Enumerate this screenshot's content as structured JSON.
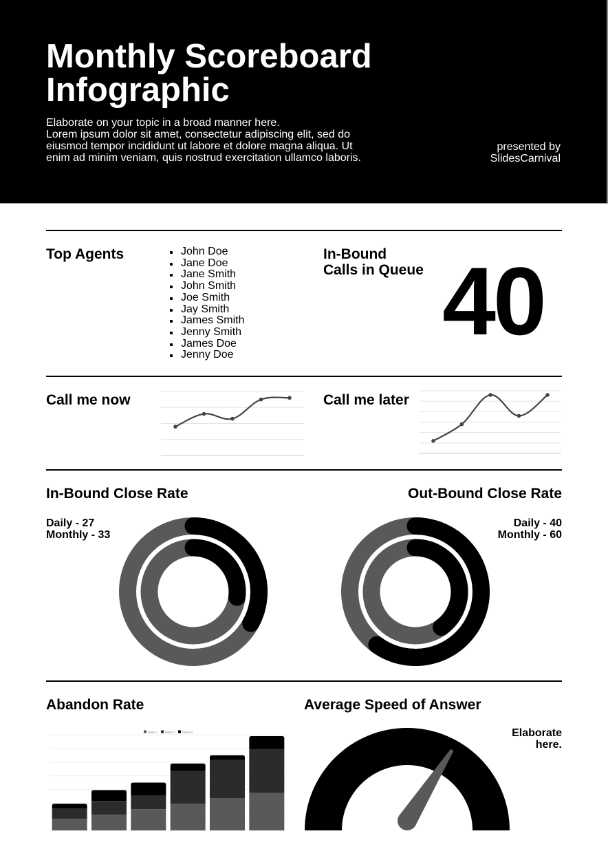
{
  "header": {
    "title_line1": "Monthly Scoreboard",
    "title_line2": "Infographic",
    "subtitle_lines": [
      "Elaborate on your topic in a broad manner here.",
      "Lorem ipsum dolor sit amet, consectetur adipiscing elit, sed do",
      "eiusmod tempor incididunt ut labore et dolore magna aliqua. Ut",
      "enim ad minim veniam, quis nostrud exercitation ullamco laboris."
    ],
    "presenter_line1": "presented by",
    "presenter_line2": "SlidesCarnival"
  },
  "top_agents": {
    "heading": "Top Agents",
    "agents": [
      "John Doe",
      "Jane Doe",
      "Jane Smith",
      "John Smith",
      "Joe Smith",
      "Jay Smith",
      "James Smith",
      "Jenny Smith",
      "James Doe",
      "Jenny Doe"
    ]
  },
  "calls_in_queue": {
    "heading_line1": "In-Bound",
    "heading_line2": "Calls in Queue",
    "value": "40"
  },
  "call_me_now": {
    "heading": "Call me now"
  },
  "call_me_later": {
    "heading": "Call me later"
  },
  "inbound_close_rate": {
    "heading": "In-Bound Close Rate",
    "daily_label": "Daily - 27",
    "monthly_label": "Monthly - 33"
  },
  "outbound_close_rate": {
    "heading": "Out-Bound Close Rate",
    "daily_label": "Daily - 40",
    "monthly_label": "Monthly - 60"
  },
  "abandon_rate": {
    "heading": "Abandon Rate"
  },
  "avg_speed": {
    "heading": "Average Speed of Answer",
    "note_line1": "Elaborate",
    "note_line2": "here."
  },
  "colors": {
    "primary": "#000000",
    "secondary": "#595959",
    "tertiary": "#2b2b2b",
    "line": "#444444",
    "grid": "#d9d9d9"
  },
  "chart_data": [
    {
      "id": "call_me_now",
      "type": "line",
      "title": "Call me now",
      "x": [
        1,
        2,
        3,
        4,
        5
      ],
      "series": [
        {
          "name": "Series 1",
          "values": [
            1.8,
            2.6,
            2.3,
            3.5,
            3.6
          ]
        }
      ],
      "ylim": [
        0,
        4
      ],
      "grid": true,
      "smooth": true
    },
    {
      "id": "call_me_later",
      "type": "line",
      "title": "Call me later",
      "x": [
        1,
        2,
        3,
        4,
        5
      ],
      "series": [
        {
          "name": "Series 1",
          "values": [
            1.2,
            2.8,
            5.6,
            3.6,
            5.6
          ]
        }
      ],
      "ylim": [
        0,
        6
      ],
      "grid": true,
      "smooth": true
    },
    {
      "id": "inbound_close_rate",
      "type": "pie",
      "variant": "concentric-progress-rings",
      "title": "In-Bound Close Rate",
      "rings": [
        {
          "name": "Monthly",
          "value": 33,
          "max": 100,
          "ring": "outer"
        },
        {
          "name": "Daily",
          "value": 27,
          "max": 100,
          "ring": "inner"
        }
      ]
    },
    {
      "id": "outbound_close_rate",
      "type": "pie",
      "variant": "concentric-progress-rings",
      "title": "Out-Bound Close Rate",
      "rings": [
        {
          "name": "Monthly",
          "value": 60,
          "max": 100,
          "ring": "outer"
        },
        {
          "name": "Daily",
          "value": 40,
          "max": 100,
          "ring": "inner"
        }
      ]
    },
    {
      "id": "abandon_rate",
      "type": "bar",
      "stacked": true,
      "title": "Abandon Rate",
      "categories": [
        "1",
        "2",
        "3",
        "4",
        "5",
        "6"
      ],
      "series": [
        {
          "name": "Series 1",
          "values": [
            0.85,
            1.15,
            1.55,
            1.95,
            2.35,
            2.75
          ]
        },
        {
          "name": "Series 2",
          "values": [
            0.75,
            1.0,
            1.0,
            2.4,
            2.8,
            3.2
          ]
        },
        {
          "name": "Series 3",
          "values": [
            0.35,
            0.8,
            0.95,
            0.55,
            0.35,
            0.95
          ]
        }
      ],
      "ylim": [
        0,
        7
      ],
      "grid": true,
      "legend": "top-center"
    },
    {
      "id": "avg_speed",
      "type": "gauge",
      "title": "Average Speed of Answer",
      "value_fraction": 0.68,
      "range": [
        0,
        1
      ]
    }
  ]
}
